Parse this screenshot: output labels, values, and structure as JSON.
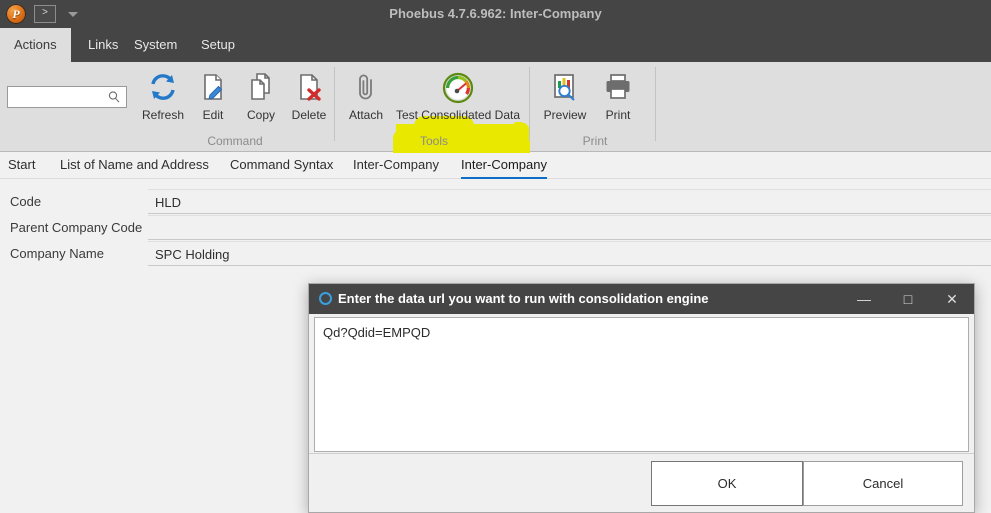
{
  "window": {
    "title": "Phoebus 4.7.6.962: Inter-Company",
    "logo_letter": "P",
    "logo_icon": "phoebus-logo-icon",
    "quick_run_label": ">",
    "quick_caret_icon": "chevron-down-icon"
  },
  "menubar": {
    "items": [
      {
        "label": "Actions",
        "active": true
      },
      {
        "label": "Links",
        "active": false
      },
      {
        "label": "System",
        "active": false
      },
      {
        "label": "Setup",
        "active": false
      }
    ]
  },
  "ribbon": {
    "search": {
      "value": "",
      "placeholder": "",
      "icon": "search-icon"
    },
    "groups": [
      {
        "label": "Command",
        "commands": [
          {
            "label": "Refresh",
            "icon": "refresh-icon"
          },
          {
            "label": "Edit",
            "icon": "edit-pencil-icon"
          },
          {
            "label": "Copy",
            "icon": "copy-icon"
          },
          {
            "label": "Delete",
            "icon": "delete-icon"
          }
        ]
      },
      {
        "label": "Tools",
        "commands": [
          {
            "label": "Attach",
            "icon": "paperclip-icon"
          },
          {
            "label": "Test Consolidated Data",
            "icon": "gauge-icon",
            "highlighted": true
          }
        ]
      },
      {
        "label": "Print",
        "commands": [
          {
            "label": "Preview",
            "icon": "print-preview-icon"
          },
          {
            "label": "Print",
            "icon": "printer-icon"
          }
        ]
      }
    ],
    "highlight_color": "#e8e800"
  },
  "doctabs": {
    "items": [
      {
        "label": "Start",
        "active": false
      },
      {
        "label": "List of Name and Address",
        "active": false
      },
      {
        "label": "Command Syntax",
        "active": false
      },
      {
        "label": "Inter-Company",
        "active": false
      },
      {
        "label": "Inter-Company",
        "active": true
      }
    ],
    "accent_color": "#0f6fc6"
  },
  "form": {
    "fields": [
      {
        "label": "Code",
        "value": "HLD"
      },
      {
        "label": "Parent Company Code",
        "value": ""
      },
      {
        "label": "Company Name",
        "value": "SPC Holding"
      }
    ]
  },
  "dialog": {
    "title": "Enter the data url you want to run with consolidation engine",
    "icon": "circle-info-icon",
    "minimize_label": "—",
    "maximize_label": "□",
    "close_label": "✕",
    "input_value": "Qd?Qdid=EMPQD",
    "input_placeholder": "",
    "ok_label": "OK",
    "cancel_label": "Cancel"
  }
}
